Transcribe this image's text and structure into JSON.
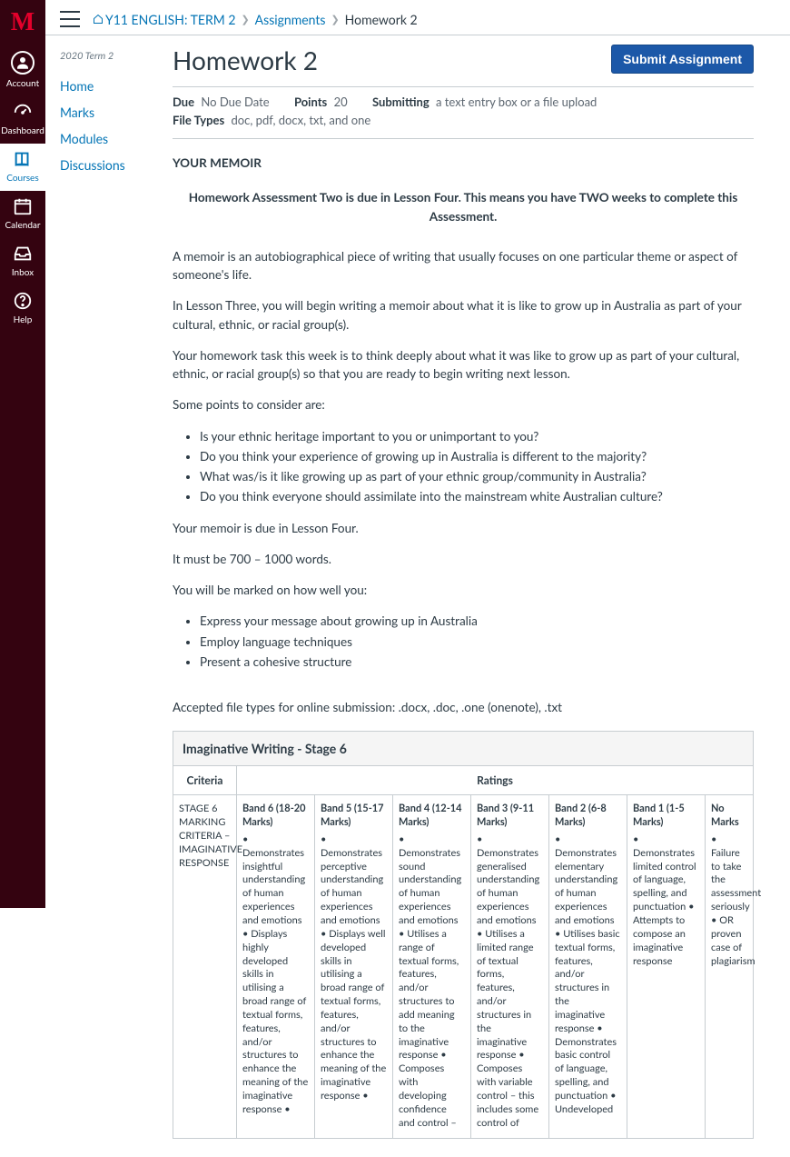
{
  "globalNav": {
    "logo": "M",
    "items": [
      {
        "id": "account",
        "label": "Account"
      },
      {
        "id": "dashboard",
        "label": "Dashboard"
      },
      {
        "id": "courses",
        "label": "Courses"
      },
      {
        "id": "calendar",
        "label": "Calendar"
      },
      {
        "id": "inbox",
        "label": "Inbox"
      },
      {
        "id": "help",
        "label": "Help"
      }
    ]
  },
  "breadcrumb": {
    "course": "Y11 ENGLISH: TERM 2",
    "section": "Assignments",
    "page": "Homework 2"
  },
  "courseNav": {
    "term": "2020 Term 2",
    "items": [
      "Home",
      "Marks",
      "Modules",
      "Discussions"
    ]
  },
  "assignment": {
    "title": "Homework 2",
    "submitLabel": "Submit Assignment",
    "meta": {
      "dueLabel": "Due",
      "dueValue": "No Due Date",
      "pointsLabel": "Points",
      "pointsValue": "20",
      "submittingLabel": "Submitting",
      "submittingValue": "a text entry box or a file upload",
      "fileTypesLabel": "File Types",
      "fileTypesValue": "doc, pdf, docx, txt, and one"
    },
    "body": {
      "heading": "YOUR MEMOIR",
      "banner": "Homework Assessment Two is due in Lesson Four. This means you have TWO weeks to complete this Assessment.",
      "p1": "A memoir is an autobiographical piece of writing that usually focuses on one particular theme or aspect of someone's life.",
      "p2": "In Lesson Three, you will begin writing a memoir about what it is like to grow up in Australia as part of your cultural, ethnic, or racial group(s).",
      "p3": "Your homework task this week is to think deeply about what it was like to grow up as part of your cultural, ethnic, or racial group(s) so that you are ready to begin writing next lesson.",
      "p4": "Some points to consider are:",
      "bullets1": [
        "Is your ethnic heritage important to you or unimportant to you?",
        "Do you think your experience of growing up in Australia is different to the majority?",
        "What was/is it like growing up as part of your ethnic group/community in Australia?",
        "Do you think everyone should assimilate into the mainstream white Australian culture?"
      ],
      "p5": "Your memoir is due in Lesson Four.",
      "p6": "It must be 700 – 1000 words.",
      "p7": "You will be marked on how well you:",
      "bullets2": [
        "Express your message about growing up in Australia",
        "Employ language techniques",
        "Present a cohesive structure"
      ],
      "p8": "Accepted file types for online submission: .docx, .doc, .one (onenote), .txt"
    }
  },
  "rubric": {
    "title": "Imaginative Writing - Stage 6",
    "criteriaLabel": "Criteria",
    "ratingsLabel": "Ratings",
    "criterion": "STAGE 6 MARKING CRITERIA – IMAGINATIVE RESPONSE",
    "cells": [
      {
        "title": "Band 6 (18-20 Marks)",
        "desc": "• Demonstrates insightful understanding of human experiences and emotions • Displays highly developed skills in utilising a broad range of textual forms, features, and/or structures to enhance the meaning of the imaginative response •"
      },
      {
        "title": "Band 5 (15-17 Marks)",
        "desc": "• Demonstrates perceptive understanding of human experiences and emotions • Displays well developed skills in utilising a broad range of textual forms, features, and/or structures to enhance the meaning of the imaginative response •"
      },
      {
        "title": "Band 4 (12-14 Marks)",
        "desc": "• Demonstrates sound understanding of human experiences and emotions • Utilises a range of textual forms, features, and/or structures to add meaning to the imaginative response • Composes with developing confidence and control –"
      },
      {
        "title": "Band 3 (9-11 Marks)",
        "desc": "• Demonstrates generalised understanding of human experiences and emotions • Utilises a limited range of textual forms, features, and/or structures in the imaginative response • Composes with variable control – this includes some control of"
      },
      {
        "title": "Band 2 (6-8 Marks)",
        "desc": "• Demonstrates elementary understanding of human experiences and emotions • Utilises basic textual forms, features, and/or structures in the imaginative response • Demonstrates basic control of language, spelling, and punctuation • Undeveloped"
      },
      {
        "title": "Band 1 (1-5 Marks)",
        "desc": "• Demonstrates limited control of language, spelling, and punctuation • Attempts to compose an imaginative response"
      },
      {
        "title": "No Marks",
        "desc": "• Failure to take the assessment seriously • OR proven case of plagiarism"
      }
    ]
  }
}
